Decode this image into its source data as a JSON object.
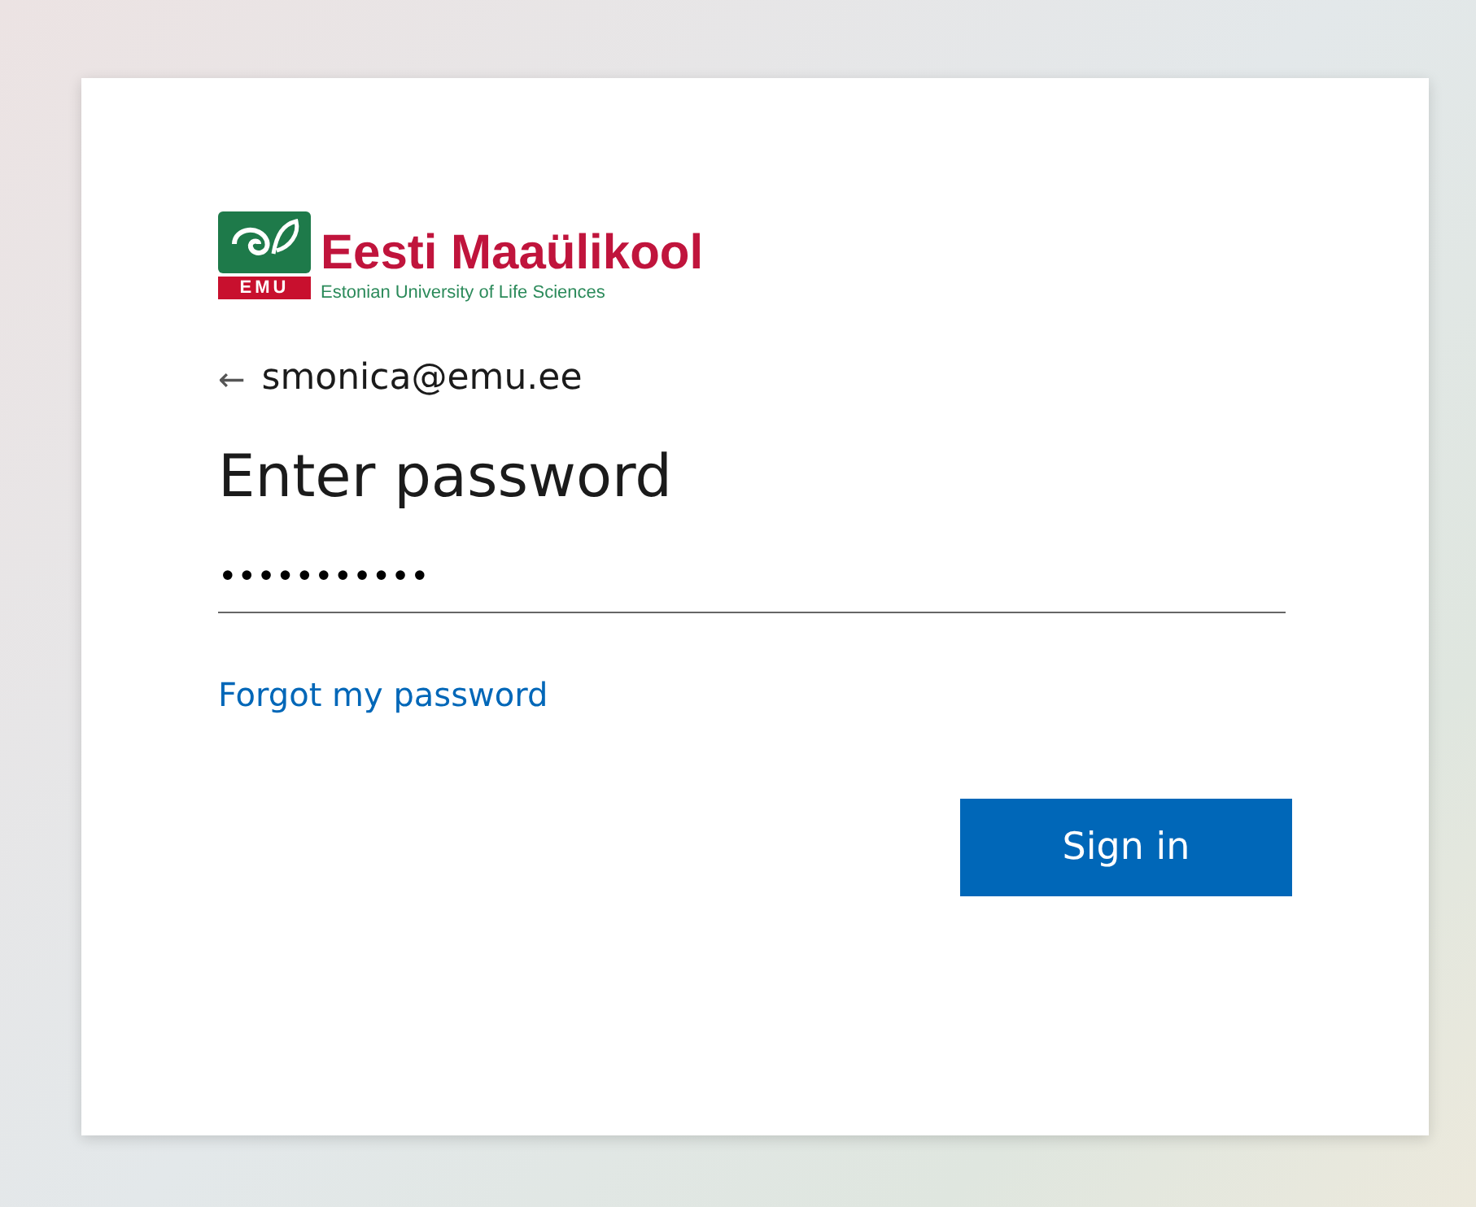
{
  "logo": {
    "name": "Eesti Maaülikool",
    "subtitle": "Estonian University of Life Sciences",
    "abbr": "EMU"
  },
  "account": {
    "back_icon": "←",
    "email": "smonica@emu.ee"
  },
  "title": "Enter password",
  "password": {
    "value": "•••••••••••"
  },
  "forgot_link": "Forgot my password",
  "buttons": [
    "Sign in"
  ]
}
